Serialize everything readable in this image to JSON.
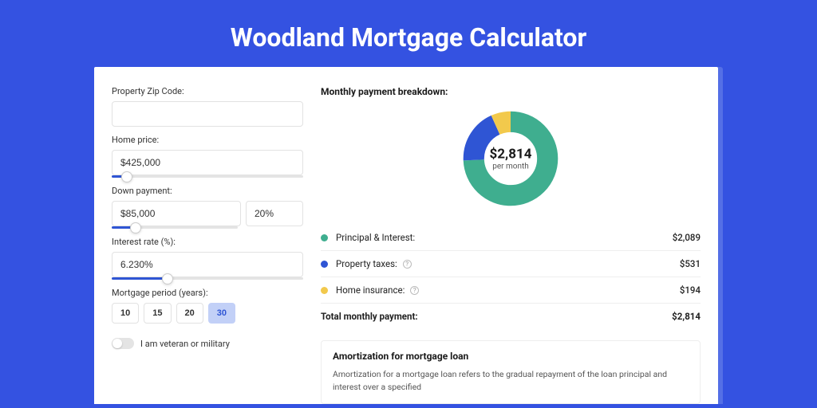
{
  "page": {
    "title": "Woodland Mortgage Calculator"
  },
  "form": {
    "zip": {
      "label": "Property Zip Code:",
      "value": ""
    },
    "homePrice": {
      "label": "Home price:",
      "value": "$425,000",
      "sliderPct": 8
    },
    "downPayment": {
      "label": "Down payment:",
      "amount": "$85,000",
      "percent": "20%",
      "sliderPct": 19
    },
    "interestRate": {
      "label": "Interest rate (%):",
      "value": "6.230%",
      "sliderPct": 29
    },
    "period": {
      "label": "Mortgage period (years):",
      "options": [
        "10",
        "15",
        "20",
        "30"
      ],
      "active": "30"
    },
    "veteran": {
      "label": "I am veteran or military",
      "on": false
    }
  },
  "breakdown": {
    "title": "Monthly payment breakdown:",
    "centerAmount": "$2,814",
    "centerSub": "per month",
    "items": [
      {
        "label": "Principal & Interest:",
        "value": "$2,089",
        "color": "#3fae8f",
        "help": false
      },
      {
        "label": "Property taxes:",
        "value": "$531",
        "color": "#2f55d4",
        "help": true
      },
      {
        "label": "Home insurance:",
        "value": "$194",
        "color": "#f2c94c",
        "help": true
      }
    ],
    "total": {
      "label": "Total monthly payment:",
      "value": "$2,814"
    }
  },
  "amortization": {
    "title": "Amortization for mortgage loan",
    "body": "Amortization for a mortgage loan refers to the gradual repayment of the loan principal and interest over a specified"
  },
  "chart_data": {
    "type": "pie",
    "title": "Monthly payment breakdown",
    "series": [
      {
        "name": "Principal & Interest",
        "value": 2089,
        "color": "#3fae8f"
      },
      {
        "name": "Property taxes",
        "value": 531,
        "color": "#2f55d4"
      },
      {
        "name": "Home insurance",
        "value": 194,
        "color": "#f2c94c"
      }
    ],
    "total": 2814,
    "center_label": "$2,814 per month"
  }
}
